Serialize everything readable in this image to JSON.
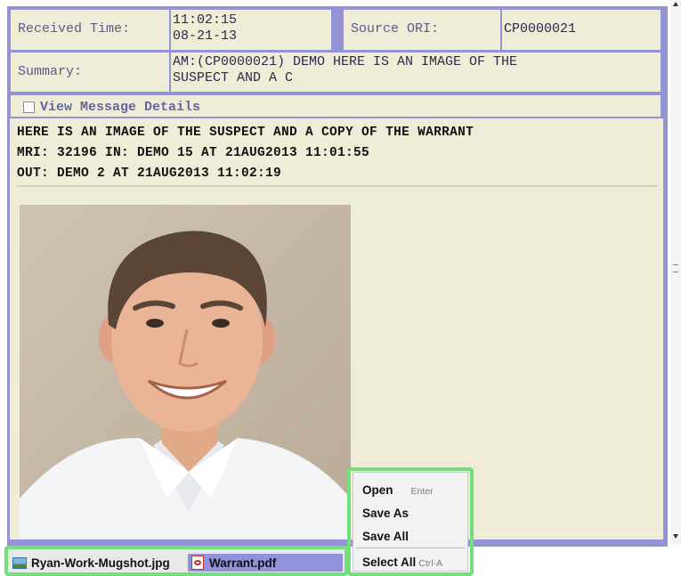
{
  "header": {
    "received_time_label": "Received Time:",
    "received_time_line1": "11:02:15",
    "received_time_line2": "08-21-13",
    "source_ori_label": "Source ORI:",
    "source_ori_value": "CP0000021",
    "summary_label": "Summary:",
    "summary_line1": "AM:(CP0000021) DEMO HERE IS AN IMAGE OF THE",
    "summary_line2": "SUSPECT AND A C"
  },
  "details": {
    "checkbox_label": "View Message Details",
    "checked": false
  },
  "message": {
    "line1": "HERE IS AN IMAGE OF THE SUSPECT AND A COPY OF THE WARRANT",
    "line2": "MRI: 32196 IN: DEMO 15 AT 21AUG2013 11:01:55",
    "line3": "OUT: DEMO 2 AT 21AUG2013 11:02:19"
  },
  "context_menu": {
    "open_label": "Open",
    "open_shortcut": "Enter",
    "save_as_label": "Save As",
    "save_all_label": "Save All",
    "select_all_label": "Select All",
    "select_all_shortcut": "Ctrl-A"
  },
  "attachments": [
    {
      "name": "Ryan-Work-Mugshot.jpg",
      "icon": "image-file-icon",
      "selected": false
    },
    {
      "name": "Warrant.pdf",
      "icon": "pdf-file-icon",
      "selected": true
    }
  ],
  "colors": {
    "frame": "#9393d6",
    "panel": "#efedd8",
    "highlight": "#6fe07a",
    "selected_tab": "#9191dd"
  }
}
